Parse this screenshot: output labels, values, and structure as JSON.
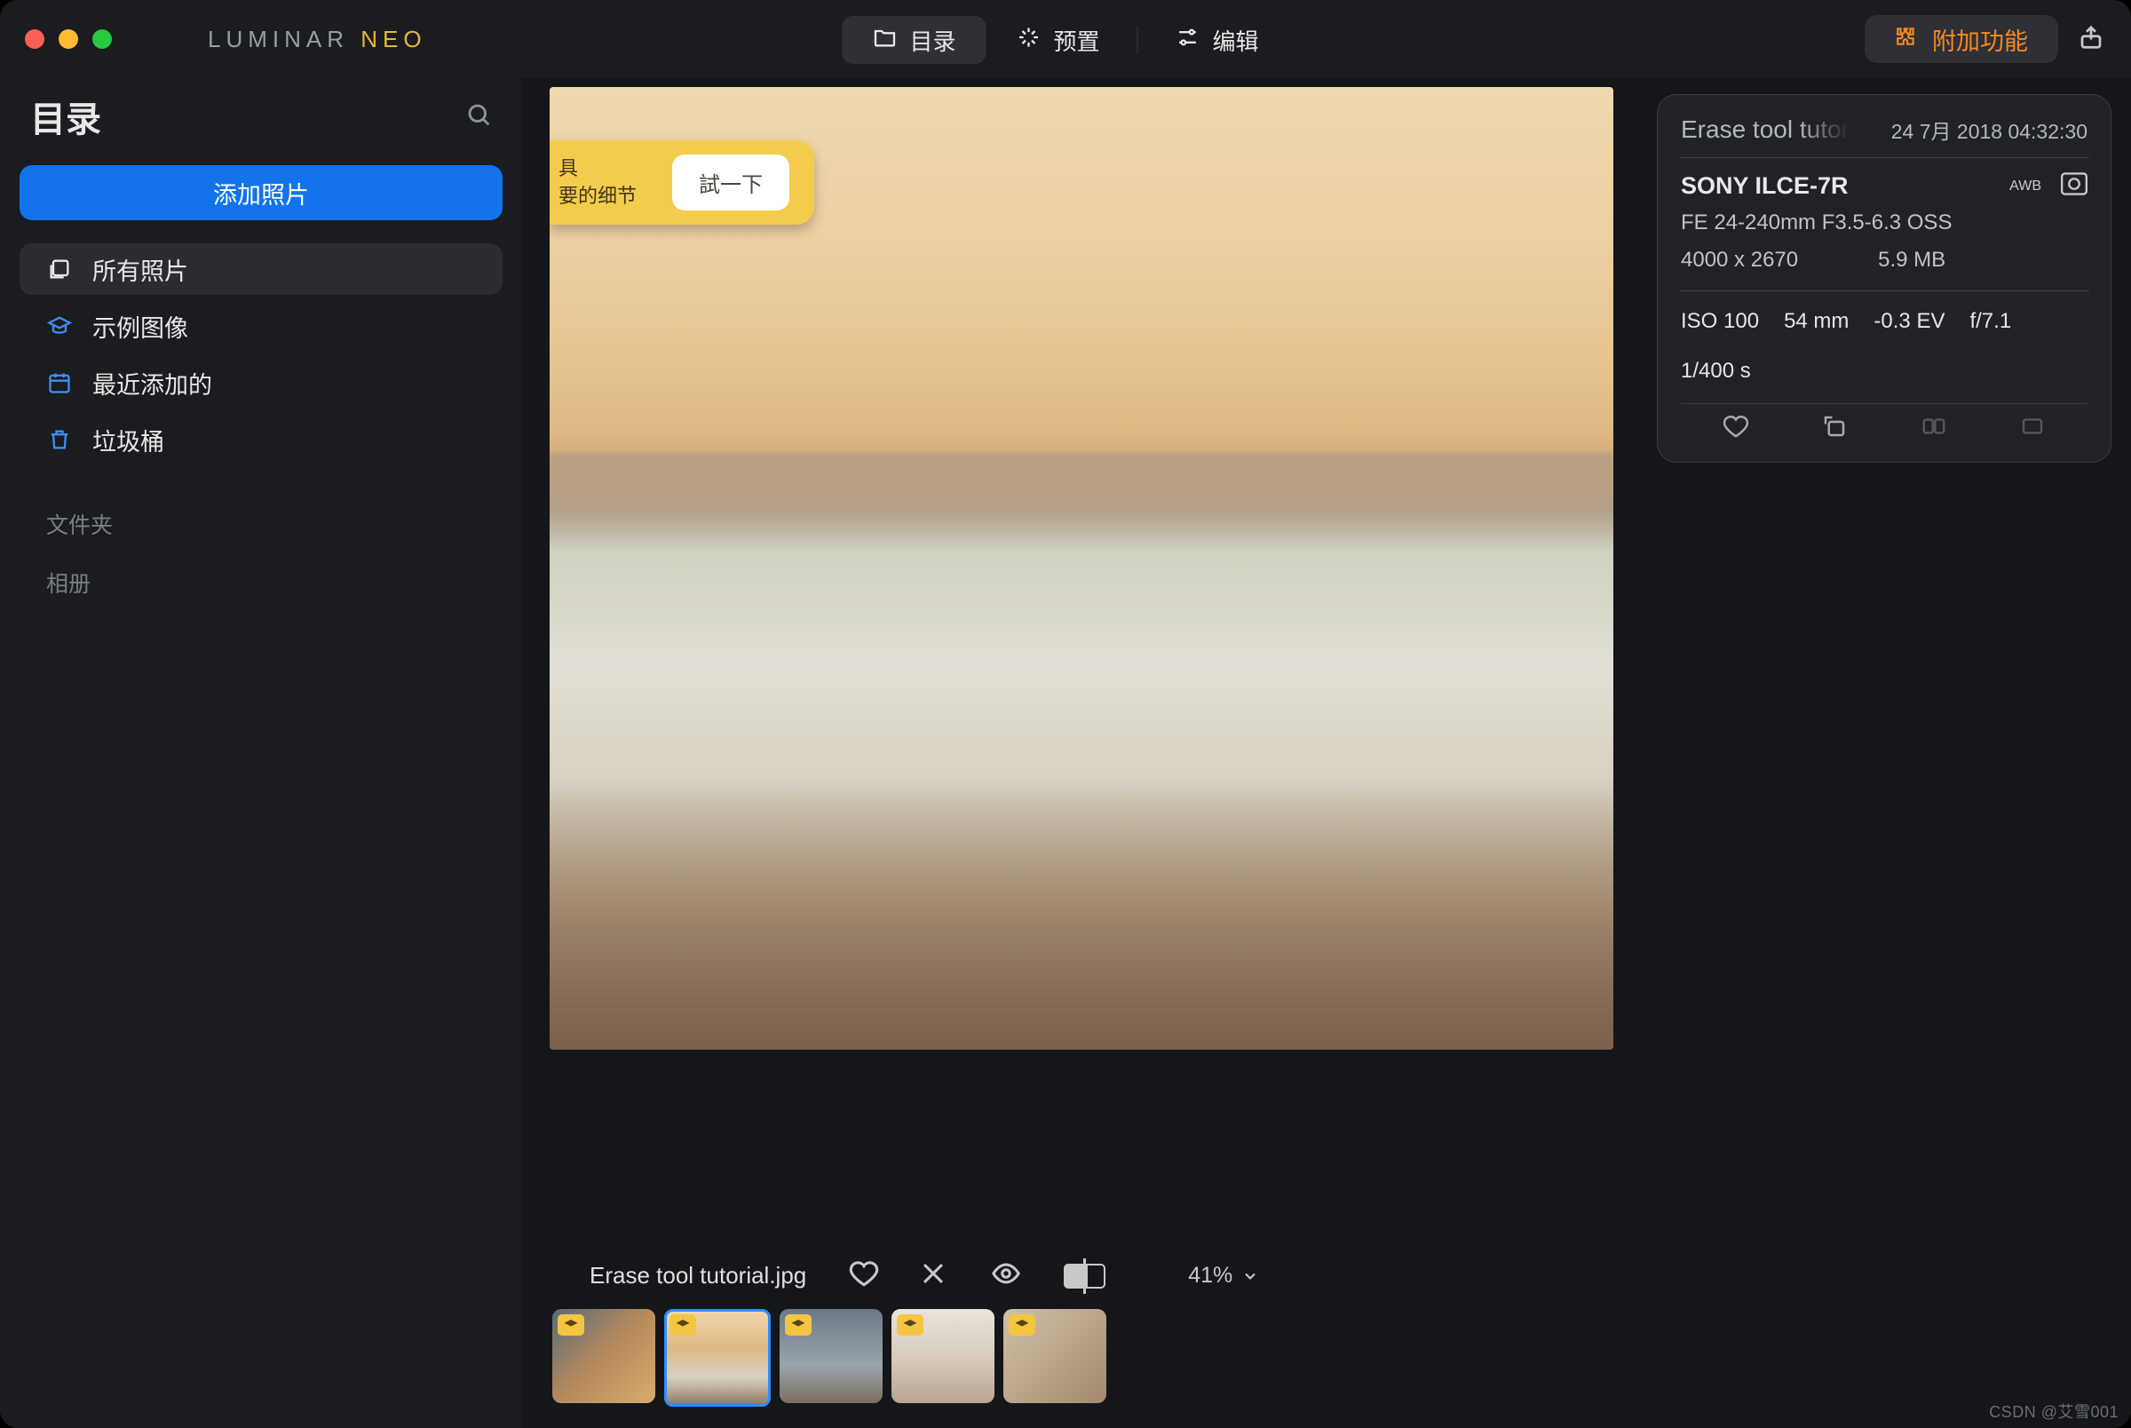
{
  "brand": {
    "name": "LUMINAR",
    "suffix": "NEO"
  },
  "header": {
    "tabs": {
      "catalog": "目录",
      "presets": "预置",
      "edit": "编辑"
    },
    "addons": "附加功能"
  },
  "sidebar": {
    "title": "目录",
    "add_button": "添加照片",
    "nav": {
      "all_photos": "所有照片",
      "sample_images": "示例图像",
      "recently_added": "最近添加的",
      "trash": "垃圾桶"
    },
    "sections": {
      "folders": "文件夹",
      "albums": "相册"
    }
  },
  "hint": {
    "line1": "具",
    "line2": "要的细节",
    "try": "試一下"
  },
  "filmstrip": {
    "filename": "Erase tool tutorial.jpg",
    "zoom": "41%"
  },
  "info": {
    "title": "Erase tool tutor",
    "date": "24 7月 2018 04:32:30",
    "camera": "SONY ILCE-7R",
    "awb": "AWB",
    "lens": "FE 24-240mm F3.5-6.3 OSS",
    "dimensions": "4000 x 2670",
    "filesize": "5.9 MB",
    "exif": {
      "iso": "ISO 100",
      "focal": "54 mm",
      "ev": "-0.3 EV",
      "aperture": "f/7.1",
      "shutter": "1/400 s"
    }
  },
  "watermark": "CSDN @艾雪001"
}
